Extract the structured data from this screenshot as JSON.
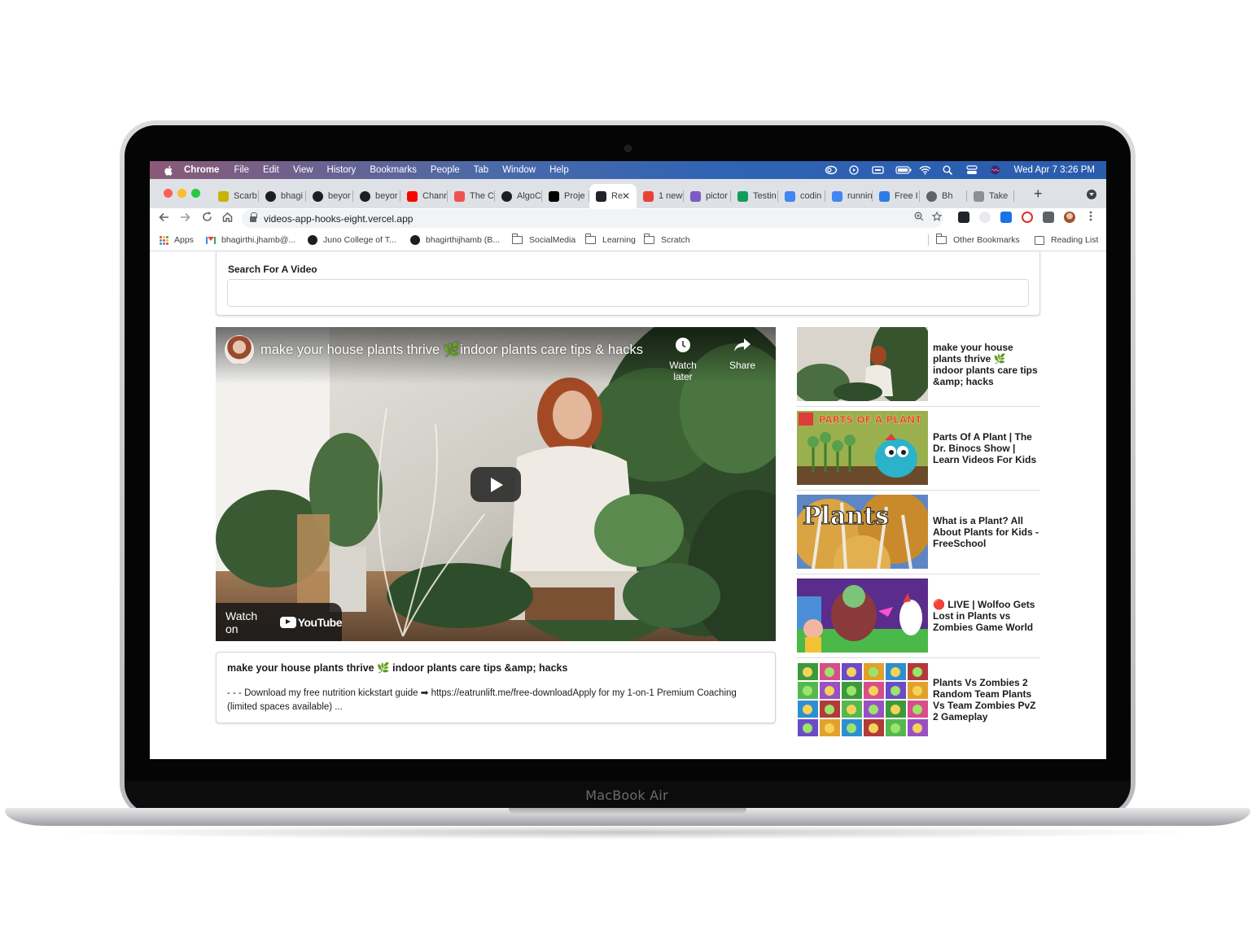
{
  "menubar": {
    "items": [
      "Chrome",
      "File",
      "Edit",
      "View",
      "History",
      "Bookmarks",
      "People",
      "Tab",
      "Window",
      "Help"
    ],
    "clock": "Wed Apr 7  3:26 PM"
  },
  "tabs": [
    {
      "label": "Scarb",
      "icon": "scarab-icon",
      "color": "#c8b400"
    },
    {
      "label": "bhagi",
      "icon": "github-icon",
      "color": "#1b1f23"
    },
    {
      "label": "beyor",
      "icon": "github-icon",
      "color": "#1b1f23"
    },
    {
      "label": "beyor",
      "icon": "github-icon",
      "color": "#1b1f23"
    },
    {
      "label": "Chann",
      "icon": "youtube-icon",
      "color": "#ff0000"
    },
    {
      "label": "The C",
      "icon": "udemy-icon",
      "color": "#ec5252"
    },
    {
      "label": "AlgoC",
      "icon": "github-icon",
      "color": "#1b1f23"
    },
    {
      "label": "Proje",
      "icon": "vercel-icon",
      "color": "#000000"
    },
    {
      "label": "Re",
      "icon": "react-icon",
      "color": "#20232a",
      "active": true
    },
    {
      "label": "1 new",
      "icon": "gmail-icon",
      "color": "#ea4335"
    },
    {
      "label": "pictor",
      "icon": "hackmd-icon",
      "color": "#7b5cc4"
    },
    {
      "label": "Testin",
      "icon": "sheets-icon",
      "color": "#0f9d58"
    },
    {
      "label": "codin",
      "icon": "google-icon",
      "color": "#4285f4"
    },
    {
      "label": "runnin",
      "icon": "google-icon",
      "color": "#4285f4"
    },
    {
      "label": "Free I",
      "icon": "layers-icon",
      "color": "#2d7be5"
    },
    {
      "label": "Bh",
      "icon": "globe-icon",
      "color": "#5f6368"
    },
    {
      "label": "Take",
      "icon": "apple-icon",
      "color": "#8e8e93"
    }
  ],
  "address_bar": {
    "url": "videos-app-hooks-eight.vercel.app"
  },
  "bookmarks": [
    {
      "label": "Apps",
      "icon": "apps-grid-icon"
    },
    {
      "label": "bhagirthi.jhamb@...",
      "icon": "gmail-icon"
    },
    {
      "label": "Juno College of T...",
      "icon": "github-icon"
    },
    {
      "label": "bhagirthijhamb (B...",
      "icon": "github-icon"
    },
    {
      "label": "SocialMedia",
      "icon": "folder-icon"
    },
    {
      "label": "Learning",
      "icon": "folder-icon"
    },
    {
      "label": "Scratch",
      "icon": "folder-icon"
    }
  ],
  "bookmarks_right": {
    "other": "Other Bookmarks",
    "reading": "Reading List"
  },
  "search": {
    "label": "Search For A Video",
    "value": ""
  },
  "player": {
    "title": "make your house plants thrive 🌿indoor plants care tips & hacks",
    "watch_later": "Watch later",
    "share": "Share",
    "watch_on": "Watch on",
    "youtube": "YouTube"
  },
  "selected_video": {
    "title": "make your house plants thrive 🌿 indoor plants care tips &amp; hacks",
    "description": "- - - Download my free nutrition kickstart guide ➡ https://eatrunlift.me/free-downloadApply for my 1-on-1 Premium Coaching (limited spaces available) ..."
  },
  "video_list": [
    {
      "title": "make your house plants thrive 🌿 indoor plants care tips &amp; hacks",
      "thumb": "plants-woman-thumbnail"
    },
    {
      "title": "Parts Of A Plant | The Dr. Binocs Show | Learn Videos For Kids",
      "thumb": "parts-of-a-plant-thumbnail",
      "thumb_text": "PARTS OF A PLANT"
    },
    {
      "title": "What is a Plant? All About Plants for Kids - FreeSchool",
      "thumb": "plants-trees-thumbnail",
      "thumb_text": "Plants"
    },
    {
      "title": "🔴 LIVE | Wolfoo Gets Lost in Plants vs Zombies Game World",
      "thumb": "wolfoo-thumbnail"
    },
    {
      "title": "Plants Vs Zombies 2 Random Team Plants Vs Team Zombies PvZ 2 Gameplay",
      "thumb": "pvz-grid-thumbnail"
    }
  ],
  "device": {
    "label": "MacBook Air"
  },
  "colors": {
    "menubar_start": "#8a5a78",
    "menubar_end": "#2a5cae",
    "tabstrip": "#dee1e6",
    "close_red": "#ff5f57",
    "minimize_yellow": "#febc2e",
    "zoom_green": "#28c840"
  }
}
